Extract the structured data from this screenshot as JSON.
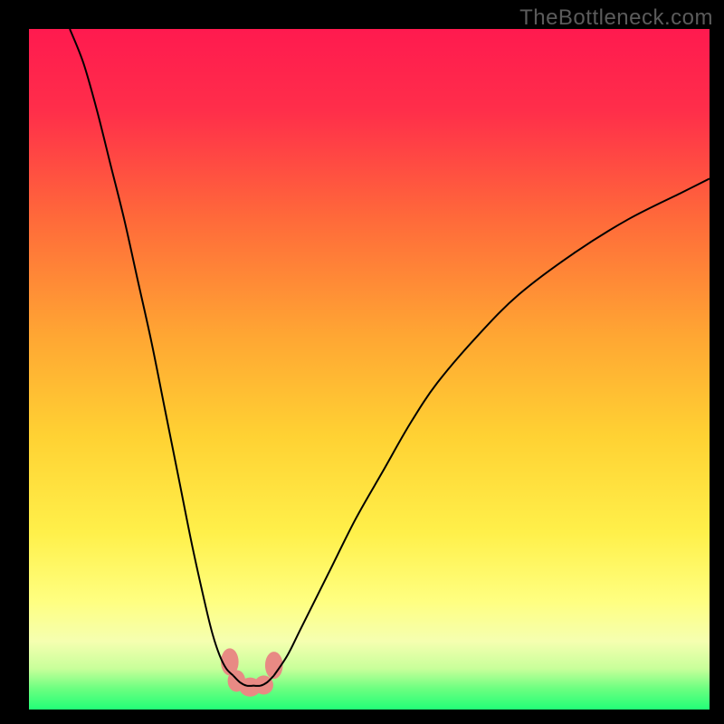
{
  "watermark": "TheBottleneck.com",
  "chart_data": {
    "type": "line",
    "title": "",
    "xlabel": "",
    "ylabel": "",
    "xlim": [
      0,
      100
    ],
    "ylim": [
      0,
      100
    ],
    "background_gradient": {
      "orientation": "vertical",
      "stops": [
        {
          "pos": 0.0,
          "color": "#ff1a4f"
        },
        {
          "pos": 0.12,
          "color": "#ff2e4a"
        },
        {
          "pos": 0.28,
          "color": "#ff6a3a"
        },
        {
          "pos": 0.45,
          "color": "#ffa633"
        },
        {
          "pos": 0.6,
          "color": "#ffd233"
        },
        {
          "pos": 0.74,
          "color": "#fff04a"
        },
        {
          "pos": 0.84,
          "color": "#ffff80"
        },
        {
          "pos": 0.9,
          "color": "#f5ffb0"
        },
        {
          "pos": 0.94,
          "color": "#c8ff9a"
        },
        {
          "pos": 0.97,
          "color": "#6aff80"
        },
        {
          "pos": 1.0,
          "color": "#22ff77"
        }
      ]
    },
    "series": [
      {
        "name": "left-curve",
        "x": [
          6,
          8,
          10,
          12,
          14,
          16,
          18,
          20,
          22,
          24,
          26,
          27,
          28,
          29,
          30
        ],
        "y": [
          100,
          95,
          88,
          80,
          72,
          63,
          54,
          44,
          34,
          24,
          15,
          11,
          8,
          6,
          5
        ]
      },
      {
        "name": "right-curve",
        "x": [
          36,
          38,
          40,
          44,
          48,
          52,
          56,
          60,
          66,
          72,
          80,
          88,
          96,
          100
        ],
        "y": [
          5,
          8,
          12,
          20,
          28,
          35,
          42,
          48,
          55,
          61,
          67,
          72,
          76,
          78
        ]
      }
    ],
    "valley_segment": {
      "x": [
        30,
        31,
        32,
        33,
        34,
        35,
        36
      ],
      "y": [
        5,
        4,
        3.5,
        3.5,
        3.5,
        4,
        5
      ]
    },
    "markers": [
      {
        "x": 29.5,
        "y": 7,
        "rx": 1.3,
        "ry": 2.0
      },
      {
        "x": 30.5,
        "y": 4.2,
        "rx": 1.3,
        "ry": 1.6
      },
      {
        "x": 32.5,
        "y": 3.3,
        "rx": 1.6,
        "ry": 1.4
      },
      {
        "x": 34.5,
        "y": 3.6,
        "rx": 1.4,
        "ry": 1.4
      },
      {
        "x": 36.0,
        "y": 6.5,
        "rx": 1.3,
        "ry": 2.0
      }
    ]
  }
}
